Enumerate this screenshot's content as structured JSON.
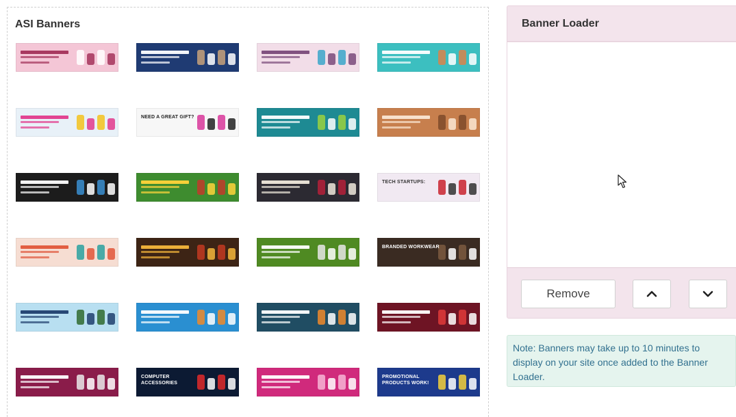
{
  "left_panel": {
    "title": "ASI Banners"
  },
  "banners": [
    {
      "name": "banner-valentines",
      "text": "",
      "bg": "#f4c6d6",
      "fg": "#a3325a",
      "accent": "#ffffff"
    },
    {
      "name": "banner-uniforms",
      "text": "",
      "bg": "#1f3b73",
      "fg": "#ffffff",
      "accent": "#c8a27a"
    },
    {
      "name": "banner-healthy",
      "text": "",
      "bg": "#f2dde8",
      "fg": "#7a4a7a",
      "accent": "#3ba6c9"
    },
    {
      "name": "banner-holiday-teal",
      "text": "",
      "bg": "#3cbfc0",
      "fg": "#ffffff",
      "accent": "#d9834a"
    },
    {
      "name": "banner-sale-new-year",
      "text": "",
      "bg": "#e8f1f8",
      "fg": "#e23a8c",
      "accent": "#f3c21d"
    },
    {
      "name": "banner-great-gift",
      "text": "NEED A GREAT GIFT?",
      "bg": "#f7f7f7",
      "fg": "#222222",
      "accent": "#d8379a"
    },
    {
      "name": "banner-affordable",
      "text": "",
      "bg": "#1e8a93",
      "fg": "#ffffff",
      "accent": "#9bd13e"
    },
    {
      "name": "banner-relaxation",
      "text": "",
      "bg": "#c77f4d",
      "fg": "#fbe7d3",
      "accent": "#7e4a2a"
    },
    {
      "name": "banner-apparel-dark",
      "text": "",
      "bg": "#1c1c1c",
      "fg": "#ffffff",
      "accent": "#3a8fd1"
    },
    {
      "name": "banner-picnic",
      "text": "",
      "bg": "#3e8c2f",
      "fg": "#ffd43a",
      "accent": "#c23a2a"
    },
    {
      "name": "banner-a-plus-branding",
      "text": "",
      "bg": "#2c2a32",
      "fg": "#f0e9dc",
      "accent": "#b5203a"
    },
    {
      "name": "banner-tech-startup",
      "text": "TECH STARTUPS:",
      "bg": "#f1e9f2",
      "fg": "#333333",
      "accent": "#c9232f"
    },
    {
      "name": "banner-umbrella",
      "text": "",
      "bg": "#f6ddd2",
      "fg": "#e0563a",
      "accent": "#2aa1a0"
    },
    {
      "name": "banner-cook",
      "text": "",
      "bg": "#3d2415",
      "fg": "#f5b73b",
      "accent": "#c23a21"
    },
    {
      "name": "banner-tee-up",
      "text": "",
      "bg": "#4f8a22",
      "fg": "#ffffff",
      "accent": "#e6e6e6"
    },
    {
      "name": "banner-branded-workwear",
      "text": "BRANDED WORKWEAR",
      "bg": "#3a2b22",
      "fg": "#ffffff",
      "accent": "#7c5a3f"
    },
    {
      "name": "banner-travel",
      "text": "",
      "bg": "#b8dff1",
      "fg": "#1f3f6e",
      "accent": "#2f6b2f"
    },
    {
      "name": "banner-efforts",
      "text": "",
      "bg": "#2a8fd1",
      "fg": "#ffffff",
      "accent": "#f08a2a"
    },
    {
      "name": "banner-school-store",
      "text": "",
      "bg": "#204d63",
      "fg": "#ffffff",
      "accent": "#f08a2a"
    },
    {
      "name": "banner-bring-on-laughter",
      "text": "",
      "bg": "#6e1424",
      "fg": "#ffffff",
      "accent": "#e03a3a"
    },
    {
      "name": "banner-wellness",
      "text": "",
      "bg": "#8a1c4a",
      "fg": "#ffffff",
      "accent": "#e9e9e9"
    },
    {
      "name": "banner-computer-accessories",
      "text": "COMPUTER ACCESSORIES",
      "bg": "#0c1a33",
      "fg": "#ffffff",
      "accent": "#e02a2a"
    },
    {
      "name": "banner-pink-ribbon",
      "text": "",
      "bg": "#d02a7c",
      "fg": "#ffffff",
      "accent": "#f7b5d6"
    },
    {
      "name": "banner-promo-work",
      "text": "Promotional Products WORK!",
      "bg": "#1d3a8c",
      "fg": "#ffffff",
      "accent": "#f3d03a"
    }
  ],
  "right_panel": {
    "title": "Banner Loader",
    "remove_label": "Remove"
  },
  "note": {
    "text": "Note: Banners may take up to 10 minutes to display on your site once added to the Banner Loader."
  },
  "colors": {
    "panel_bg": "#f3e4ec",
    "note_bg": "#e5f4ee",
    "note_text": "#31708f"
  }
}
